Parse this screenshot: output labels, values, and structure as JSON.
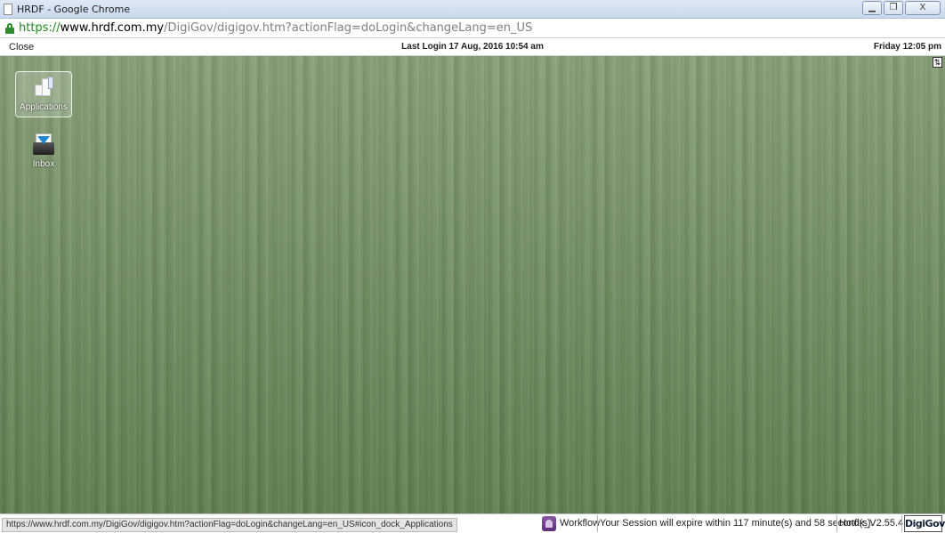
{
  "window": {
    "title": "HRDF - Google Chrome",
    "buttons": {
      "minimize": "▁",
      "restore": "❐",
      "close": "X"
    }
  },
  "address": {
    "scheme": "https://",
    "host": "www.hrdf.com.my",
    "path": "/DigiGov/digigov.htm?actionFlag=doLogin&changeLang=en_US"
  },
  "infobar": {
    "close_label": "Close",
    "last_login": "Last Login 17 Aug, 2016 10:54 am",
    "clock": "Friday 12:05 pm"
  },
  "desktop": {
    "toggle_glyph": "⇅",
    "items": [
      {
        "label": "Applications",
        "icon": "applications-icon",
        "selected": true
      },
      {
        "label": "Inbox",
        "icon": "inbox-icon",
        "selected": false
      }
    ]
  },
  "statusbar": {
    "hover_url": "https://www.hrdf.com.my/DigiGov/digigov.htm?actionFlag=doLogin&changeLang=en_US#icon_dock_Applications",
    "workflow_label": "Workflow",
    "session_text": "Your Session will expire within 117 minute(s) and 58 second(s).",
    "version": "Hotfix_V2.55.4.1",
    "logo_text": "DigiGov"
  }
}
